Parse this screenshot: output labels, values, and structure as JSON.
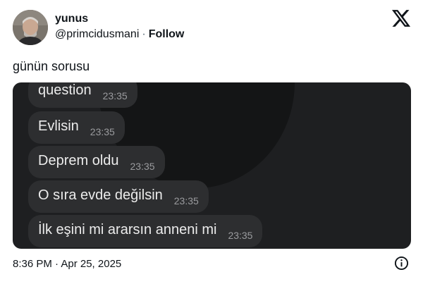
{
  "author": {
    "name": "yunus",
    "handle": "@primcidusmani",
    "separator": "·",
    "follow_label": "Follow"
  },
  "platform_icon": "x-logo-icon",
  "tweet_text": "günün sorusu",
  "chat_messages": [
    {
      "text": "question",
      "time": "23:35"
    },
    {
      "text": "Evlisin",
      "time": "23:35"
    },
    {
      "text": "Deprem oldu",
      "time": "23:35"
    },
    {
      "text": "O sıra evde değilsin",
      "time": "23:35"
    },
    {
      "text": "İlk eşini mi ararsın anneni mi",
      "time": "23:35"
    }
  ],
  "timestamp": "8:36 PM · Apr 25, 2025",
  "info_icon": "info-icon",
  "colors": {
    "text": "#0f1419",
    "chat_background": "#1e1f21",
    "bubble": "#2d2e30",
    "bubble_text": "#ececec",
    "bubble_time": "#9a9b9e"
  }
}
